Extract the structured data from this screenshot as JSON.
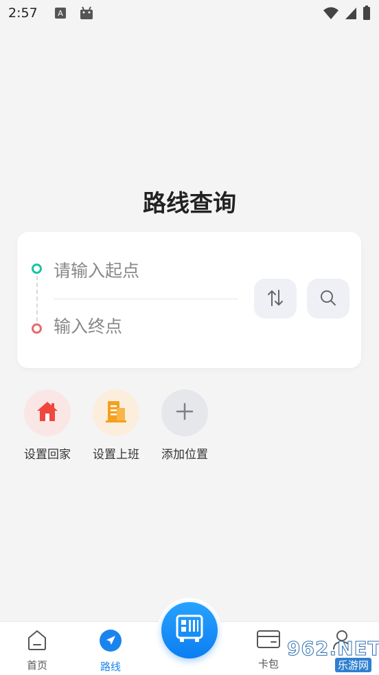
{
  "status_bar": {
    "time": "2:57"
  },
  "page": {
    "title": "路线查询"
  },
  "route_form": {
    "start_placeholder": "请输入起点",
    "end_placeholder": "输入终点",
    "start_value": "",
    "end_value": ""
  },
  "shortcuts": [
    {
      "label": "设置回家",
      "icon": "home-icon",
      "color": "#f05050",
      "bg": "#fbe8e8"
    },
    {
      "label": "设置上班",
      "icon": "building-icon",
      "color": "#f59a23",
      "bg": "#fbefe0"
    },
    {
      "label": "添加位置",
      "icon": "plus-icon",
      "color": "#7a7f88",
      "bg": "#e8e9ec"
    }
  ],
  "bottom_nav": {
    "items": [
      {
        "label": "首页",
        "icon": "home-outline-icon",
        "active": false
      },
      {
        "label": "路线",
        "icon": "navigation-arrow-icon",
        "active": true
      },
      {
        "label": "卡包",
        "icon": "card-icon",
        "active": false
      },
      {
        "label": "",
        "icon": "user-icon",
        "active": false
      }
    ],
    "center_button_icon": "bus-qr-icon",
    "accent_color": "#1a84ee"
  },
  "watermark": {
    "main": "962",
    "net": ".NET",
    "sub": "乐游网"
  }
}
